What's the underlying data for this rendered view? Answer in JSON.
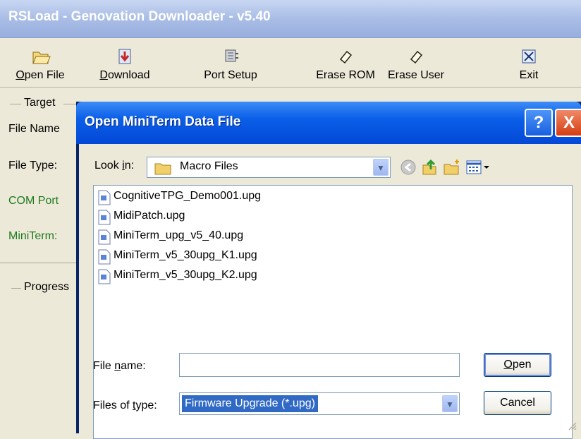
{
  "main_window": {
    "title": "RSLoad  -  Genovation Downloader  -  v5.40",
    "toolbar": [
      {
        "label_pre": "",
        "label_u": "O",
        "label_post": "pen File",
        "icon": "open-folder-icon"
      },
      {
        "label_pre": "",
        "label_u": "D",
        "label_post": "ownload",
        "icon": "download-icon"
      },
      {
        "label_pre": "Port Setup",
        "label_u": "",
        "label_post": "",
        "icon": "port-setup-icon"
      },
      {
        "label_pre": "Erase ROM",
        "label_u": "",
        "label_post": "",
        "icon": "eraser-icon"
      },
      {
        "label_pre": "Erase User",
        "label_u": "",
        "label_post": "",
        "icon": "eraser-icon"
      },
      {
        "label_pre": "Exit",
        "label_u": "",
        "label_post": "",
        "icon": "exit-icon"
      }
    ],
    "target_group": "Target",
    "labels": {
      "file_name": "File Name",
      "file_type": "File Type:",
      "com_port": "COM Port",
      "miniterm": "MiniTerm:"
    },
    "progress_group": "Progress"
  },
  "dialog": {
    "title": "Open MiniTerm Data File",
    "help_button": "?",
    "close_button": "X",
    "look_in_label_pre": "Look ",
    "look_in_label_u": "i",
    "look_in_label_post": "n:",
    "look_in_value": "Macro Files",
    "files": [
      "CognitiveTPG_Demo001.upg",
      "MidiPatch.upg",
      "MiniTerm_upg_v5_40.upg",
      "MiniTerm_v5_30upg_K1.upg",
      "MiniTerm_v5_30upg_K2.upg"
    ],
    "file_name_label_pre": "File ",
    "file_name_label_u": "n",
    "file_name_label_post": "ame:",
    "file_name_value": "",
    "files_of_type_label_pre": "Files of ",
    "files_of_type_label_u": "t",
    "files_of_type_label_post": "ype:",
    "files_of_type_value": "Firmware Upgrade (*.upg)",
    "open_button_u": "O",
    "open_button_post": "pen",
    "cancel_button": "Cancel"
  },
  "colors": {
    "xp_blue": "#0348d6",
    "window_bg": "#ece9d8",
    "green_label": "#1e7a1e",
    "selection": "#316ac5"
  }
}
